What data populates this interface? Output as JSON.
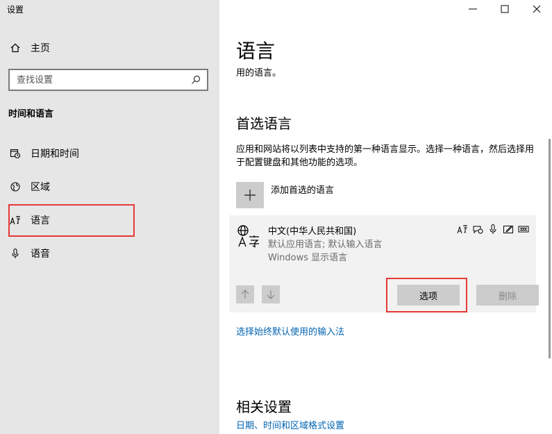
{
  "window": {
    "title": "设置"
  },
  "sidebar": {
    "home_label": "主页",
    "search_placeholder": "查找设置",
    "section_title": "时间和语言",
    "items": [
      {
        "label": "日期和时间",
        "icon": "calendar-clock-icon"
      },
      {
        "label": "区域",
        "icon": "globe-icon"
      },
      {
        "label": "语言",
        "icon": "language-icon"
      },
      {
        "label": "语音",
        "icon": "microphone-icon"
      }
    ]
  },
  "main": {
    "title": "语言",
    "subtitle": "用的语言。",
    "preferred": {
      "heading": "首选语言",
      "description": "应用和网站将以列表中支持的第一种语言显示。选择一种语言，然后选择用于配置键盘和其他功能的选项。",
      "add_label": "添加首选的语言",
      "language": {
        "name": "中文(中华人民共和国)",
        "defaults": "默认应用语言; 默认输入语言",
        "display": "Windows 显示语言"
      },
      "options_label": "选项",
      "remove_label": "删除"
    },
    "input_method_link": "选择始终默认使用的输入法",
    "related": {
      "heading": "相关设置",
      "link": "日期、时间和区域格式设置"
    }
  },
  "colors": {
    "sidebar_bg": "#e6e6e6",
    "accent_link": "#0063b1",
    "highlight": "#e53935"
  }
}
